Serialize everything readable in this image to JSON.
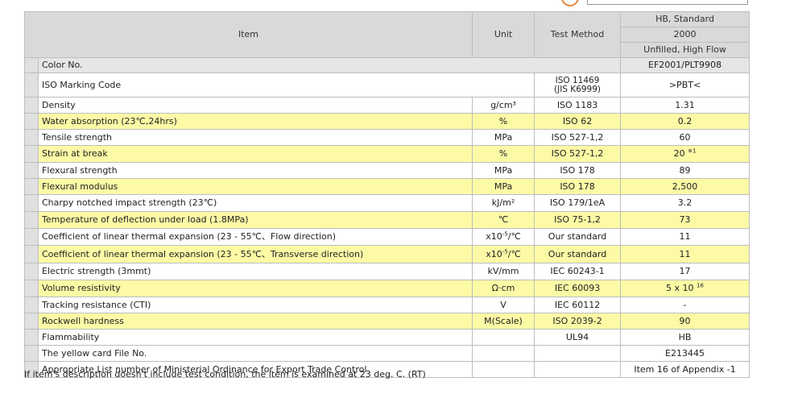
{
  "header": {
    "item": "Item",
    "unit": "Unit",
    "test_method": "Test Method",
    "grade_line1": "HB, Standard",
    "grade_line2": "2000",
    "grade_line3": "Unfilled, High Flow"
  },
  "color_row": {
    "label": "Color No.",
    "value": "EF2001/PLT9908"
  },
  "marking_row": {
    "label": "ISO Marking Code",
    "method_line1": "ISO 11469",
    "method_line2": "(JIS K6999)",
    "value": ">PBT<"
  },
  "rows": [
    {
      "label": "Density",
      "unit": "g/cm³",
      "method": "ISO 1183",
      "value": "1.31",
      "highlight": false
    },
    {
      "label": "Water absorption (23℃,24hrs)",
      "unit": "%",
      "method": "ISO 62",
      "value": "0.2",
      "highlight": true
    },
    {
      "label": "Tensile strength",
      "unit": "MPa",
      "method": "ISO 527-1,2",
      "value": "60",
      "highlight": false
    },
    {
      "label": "Strain at break",
      "unit": "%",
      "method": "ISO 527-1,2",
      "value": "20",
      "value_sup": "※1",
      "highlight": true
    },
    {
      "label": "Flexural strength",
      "unit": "MPa",
      "method": "ISO 178",
      "value": "89",
      "highlight": false
    },
    {
      "label": "Flexural modulus",
      "unit": "MPa",
      "method": "ISO 178",
      "value": "2,500",
      "highlight": true
    },
    {
      "label": "Charpy notched impact strength (23℃)",
      "unit": "kJ/m²",
      "method": "ISO 179/1eA",
      "value": "3.2",
      "highlight": false
    },
    {
      "label": "Temperature of deflection under load (1.8MPa)",
      "unit": "℃",
      "method": "ISO 75-1,2",
      "value": "73",
      "highlight": true
    },
    {
      "label": "Coefficient of linear thermal expansion (23 - 55℃、Flow direction)",
      "unit": "x10",
      "unit_sup": "-5",
      "unit_suffix": "/℃",
      "method": "Our standard",
      "value": "11",
      "highlight": false
    },
    {
      "label": "Coefficient of linear thermal expansion (23 - 55℃、Transverse direction)",
      "unit": "x10",
      "unit_sup": "-5",
      "unit_suffix": "/℃",
      "method": "Our standard",
      "value": "11",
      "highlight": true
    },
    {
      "label": "Electric strength (3mmt)",
      "unit": "kV/mm",
      "method": "IEC 60243-1",
      "value": "17",
      "highlight": false
    },
    {
      "label": "Volume resistivity",
      "unit": "Ω·cm",
      "method": "IEC 60093",
      "value": "5 x 10",
      "value_sup": "16",
      "highlight": true
    },
    {
      "label": "Tracking resistance (CTI)",
      "unit": "V",
      "method": "IEC 60112",
      "value": "-",
      "highlight": false
    },
    {
      "label": "Rockwell hardness",
      "unit": "M(Scale)",
      "method": "ISO 2039-2",
      "value": "90",
      "highlight": true
    },
    {
      "label": "Flammability",
      "unit": "",
      "method": "UL94",
      "value": "HB",
      "highlight": false
    },
    {
      "label": "The yellow card File No.",
      "unit": "",
      "method": "",
      "value": "E213445",
      "highlight": false
    },
    {
      "label": "Appropriate List number of Ministerial Ordinance for Export Trade Control",
      "unit": "",
      "method": "",
      "value": "Item 16 of Appendix -1",
      "highlight": false
    }
  ],
  "footnote": "If item's description doesn't include test condition, the item is examined at 23 deg. C. (RT)",
  "colors": {
    "header_bg": "#d9d9d9",
    "highlight_bg": "#fdfaa6",
    "border": "#bdbdbd",
    "accent_circle": "#e8833a"
  }
}
